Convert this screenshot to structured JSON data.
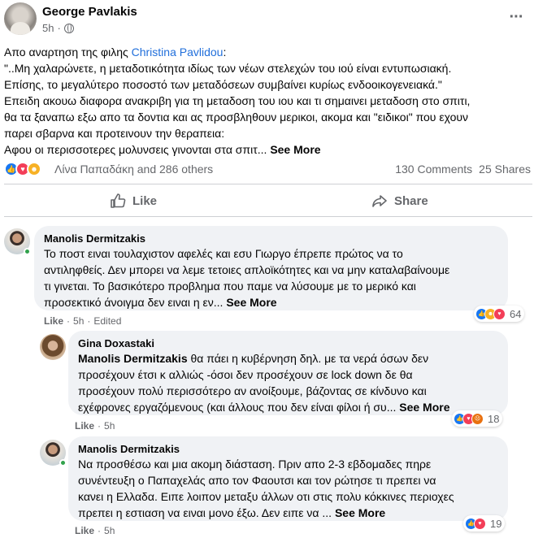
{
  "post": {
    "author": "George Pavlakis",
    "time": "5h",
    "text_lines": [
      "Απο αναρτηση της φιλης ",
      "\"..Μη χαλαρώνετε, η μεταδοτικότητα ιδίως των νέων στελεχών του ιού είναι εντυπωσιακή.",
      "Επίσης, το μεγαλύτερο ποσοστό των μεταδόσεων συμβαίνει κυρίως ενδοοικογενειακά.\"",
      "Επειδη ακουω διαφορα ανακριβη για τη μεταδοση του ιου και τι σημαινει μεταδοση στο σπιτι,",
      "θα τα ξαναπω εξω απο τα δοντια και ας προσβληθουν μερικοι, ακομα και \"ειδικοι\" που εχουν",
      "παρει σβαρνα και προτεινουν την θεραπεια:",
      "Αφου οι περισσοτερες μολυνσεις γινονται στα σπιτ... "
    ],
    "mention": "Christina Pavlidou",
    "mention_suffix": ":",
    "see_more": "See More",
    "reactors": "Λίνα Παπαδάκη and 286 others",
    "comments_count": "130 Comments",
    "shares_count": "25 Shares",
    "like_label": "Like",
    "share_label": "Share"
  },
  "comments": [
    {
      "name": "Manolis Dermitzakis",
      "lines": [
        "Το ποστ ειναι τουλαχιστον αφελές και εσυ Γιωργο έπρεπε πρώτος να το",
        "αντιληφθείς. Δεν μπορει να λεμε τετοιες απλοϊκότητες και να μην καταλαβαίνουμε",
        "τι γινεται. Το βασικότερο προβλημα που παμε να λύσουμε με το μερικό και",
        "προσεκτικό άνοιγμα δεν ειναι η εν... "
      ],
      "see_more": "See More",
      "like": "Like",
      "time": "5h",
      "edited": "Edited",
      "reaction_count": "64"
    },
    {
      "name": "Gina Doxastaki",
      "mention": "Manolis Dermitzakis",
      "lines": [
        " θα πάει η κυβέρνηση δηλ. με τα νερά όσων δεν",
        "προσέχουν έτσι κ αλλιώς -όσοι δεν προσέχουν σε lock down δε θα",
        "προσέχουν πολύ περισσότερο αν ανοίξουμε, βάζοντας σε κίνδυνο και",
        "εχέφρονες εργαζόμενους (και άλλους που δεν είναι φίλοι ή συ... "
      ],
      "see_more": "See More",
      "like": "Like",
      "time": "5h",
      "reaction_count": "18"
    },
    {
      "name": "Manolis Dermitzakis",
      "lines": [
        "Να προσθέσω και μια ακομη διάσταση. Πριν απο 2-3 εβδομαδες πηρε",
        "συνέντευξη ο Παπαχελάς απο τον Φαουτσι και τον ρώτησε τι πρεπει να",
        "κανει η Ελλαδα. Ειπε λοιπον μεταξυ άλλων οτι στις πολυ κόκκινες περιοχες",
        "πρεπει η εστιαση να ειναι μονο έξω. Δεν ειπε να ... "
      ],
      "see_more": "See More",
      "like": "Like",
      "time": "5h",
      "reaction_count": "19"
    }
  ],
  "colors": {
    "accent": "#216fdb",
    "like_blue": "#1877f2",
    "love_red": "#f33e58",
    "haha_yellow": "#f7b125"
  }
}
